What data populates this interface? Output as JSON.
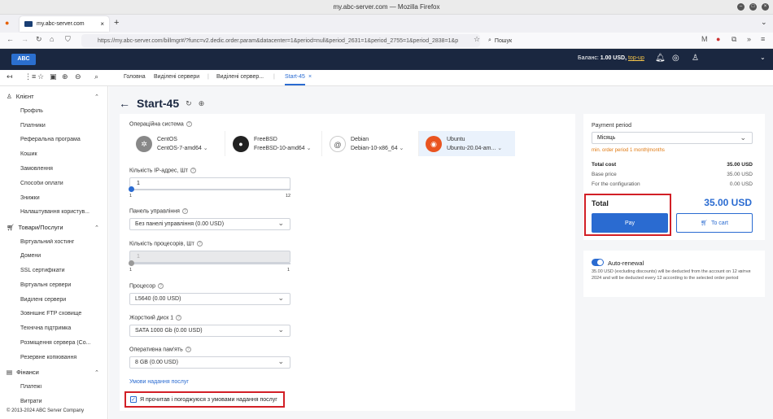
{
  "browser": {
    "window_title": "my.abc-server.com — Mozilla Firefox",
    "tab_title": "my.abc-server.com",
    "url": "https://my.abc-server.com/billmgr#/?func=v2.dedic.order.param&datacenter=1&period=null&period_2631=1&period_2755=1&period_2838=1&p",
    "search_placeholder": "Пошук"
  },
  "header": {
    "logo": "ABC",
    "balance_label": "Баланс:",
    "balance_value": "1.00 USD,",
    "topup": "top-up"
  },
  "breadcrumbs": [
    "Головна",
    "Виділені сервери",
    "Виділені сервер...",
    "Start-45"
  ],
  "sidebar": {
    "client": {
      "label": "Клієнт",
      "items": [
        "Профіль",
        "Платники",
        "Реферальна програма",
        "Кошик",
        "Замовлення",
        "Способи оплати",
        "Знижки",
        "Налаштування користув..."
      ]
    },
    "products": {
      "label": "Товари/Послуги",
      "items": [
        "Віртуальний хостинг",
        "Домени",
        "SSL сертифікати",
        "Віртуальні сервери",
        "Виділені сервери",
        "Зовнішнє FTP сховище",
        "Технічна підтримка",
        "Розміщення сервера (Co...",
        "Резервне копіювання"
      ]
    },
    "finance": {
      "label": "Фінанси",
      "items": [
        "Платежі",
        "Витрати"
      ]
    },
    "copyright": "© 2013-2024 ABC Server Company"
  },
  "page": {
    "title": "Start-45",
    "back_arrow": "←"
  },
  "form": {
    "os_label": "Операційна система",
    "os": [
      {
        "name": "CentOS",
        "version": "CentOS-7-amd64"
      },
      {
        "name": "FreeBSD",
        "version": "FreeBSD-10-amd64"
      },
      {
        "name": "Debian",
        "version": "Debian-10-x86_64"
      },
      {
        "name": "Ubuntu",
        "version": "Ubuntu-20.04-am..."
      }
    ],
    "ip_label": "Кількість IP-адрес, Шт",
    "ip_value": "1",
    "ip_min": "1",
    "ip_max": "12",
    "panel_label": "Панель управління",
    "panel_value": "Без панелі управління (0.00 USD)",
    "cpu_count_label": "Кількість процесорів, Шт",
    "cpu_count_value": "1",
    "cpu_min": "1",
    "cpu_max": "1",
    "cpu_label": "Процесор",
    "cpu_value": "L5640 (0.00 USD)",
    "disk_label": "Жорсткий диск 1",
    "disk_value": "SATA 1000 Gb (0.00 USD)",
    "ram_label": "Оперативна пам'ять",
    "ram_value": "8 GB (0.00 USD)",
    "terms_link": "Умови надання послуг",
    "agree_label": "Я прочитав і погоджуюся з умовами надання послуг"
  },
  "order": {
    "period_label": "Payment period",
    "period_value": "Місяць",
    "min_order": "min. order period 1 month|months",
    "rows": [
      {
        "label": "Total cost",
        "value": "35.00 USD"
      },
      {
        "label": "Base price",
        "value": "35.00 USD"
      },
      {
        "label": "For the configuration",
        "value": "0.00 USD"
      }
    ],
    "total_label": "Total",
    "total_value": "35.00 USD",
    "pay": "Pay",
    "cart": "To cart",
    "renew_label": "Auto-renewal",
    "renew_desc": "35.00 USD (excluding discounts) will be deducted from the account on 12 квітня 2024 and will be deducted every 12 according to the selected order period"
  },
  "colors": {
    "accent": "#2a6bd1",
    "header_bg": "#1a2740",
    "highlight": "#d21f26"
  }
}
